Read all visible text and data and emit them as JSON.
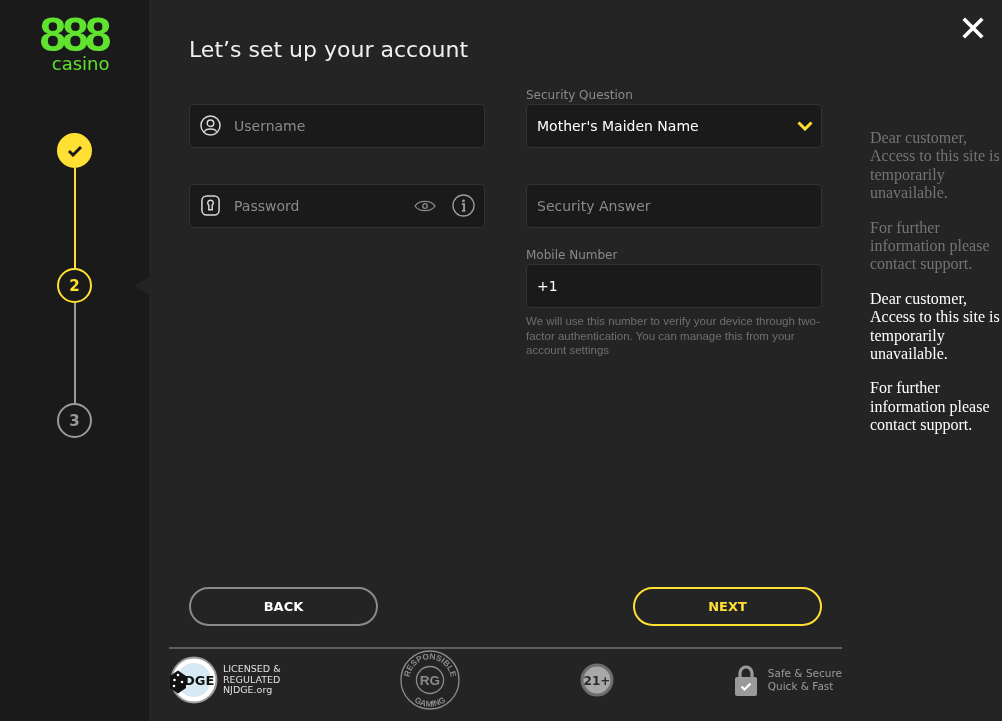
{
  "sidebar": {
    "logo": {
      "number": "888",
      "word": "casino"
    },
    "steps": [
      {
        "completed": true,
        "selected": false
      },
      {
        "number": "2",
        "completed": false,
        "selected": true
      },
      {
        "number": "3",
        "completed": false,
        "selected": false
      }
    ]
  },
  "form": {
    "title": "Let’s set up your account",
    "columns": [
      {
        "fields": [
          {
            "kind": "username",
            "placeholder": "Username"
          },
          {
            "kind": "password",
            "placeholder": "Password"
          }
        ]
      },
      {
        "fields": [
          {
            "kind": "select",
            "label": "Security Question",
            "value": "Mother's Maiden Name"
          },
          {
            "kind": "text",
            "placeholder": "Security Answer"
          },
          {
            "kind": "phone",
            "label": "Mobile Number",
            "value": "+1",
            "help": "We will use this number to verify your device through two- factor authentication. You can manage this from your account settings"
          }
        ]
      }
    ],
    "actions": [
      {
        "kind": "secondary",
        "label": "BACK"
      },
      {
        "kind": "primary",
        "label": "NEXT"
      }
    ]
  },
  "footer": {
    "badges": [
      {
        "kind": "regulator",
        "seal": "DGE",
        "lines": [
          "LICENSED &",
          "REGULATED",
          "NJDGE.org"
        ]
      },
      {
        "kind": "responsible",
        "text": "RG",
        "top": "RESPONSIBLE",
        "bottom": "GAMING"
      },
      {
        "kind": "age",
        "text": "21+"
      },
      {
        "kind": "secure",
        "lines": [
          "Safe & Secure",
          "Quick & Fast"
        ]
      }
    ]
  },
  "notices": [
    {
      "dimmed": true,
      "paragraphs": [
        "Dear customer, Access to this site is temporarily unavailable.",
        "For further information please contact support."
      ]
    },
    {
      "dimmed": false,
      "paragraphs": [
        "Dear customer, Access to this site is temporarily unavailable.",
        "For further information please contact support."
      ]
    }
  ]
}
